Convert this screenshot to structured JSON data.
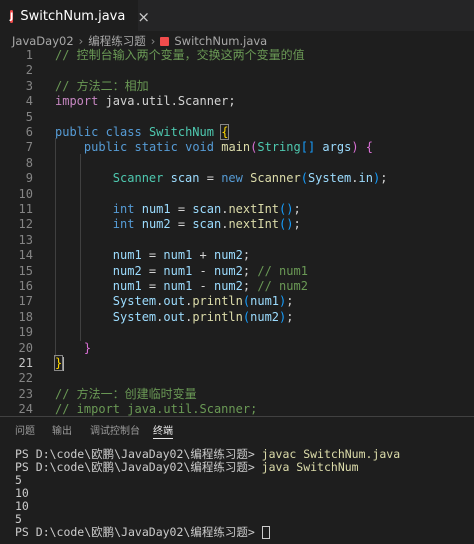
{
  "tab": {
    "icon": "J",
    "label": "SwitchNum.java",
    "close": "×"
  },
  "breadcrumb": {
    "parts": [
      "JavaDay02",
      "编程练习题",
      "SwitchNum.java"
    ],
    "separator": "›"
  },
  "editor": {
    "active_line": "21",
    "lines": [
      {
        "n": "1",
        "guides": [],
        "tokens": [
          {
            "t": "// 控制台输入两个变量，交换这两个变量的值",
            "c": "cm"
          }
        ]
      },
      {
        "n": "2",
        "guides": [],
        "tokens": []
      },
      {
        "n": "3",
        "guides": [],
        "tokens": [
          {
            "t": "// 方法二：相加",
            "c": "cm"
          }
        ]
      },
      {
        "n": "4",
        "guides": [],
        "tokens": [
          {
            "t": "import",
            "c": "kwc"
          },
          {
            "t": " java.util.Scanner;",
            "c": "pl"
          }
        ]
      },
      {
        "n": "5",
        "guides": [],
        "tokens": []
      },
      {
        "n": "6",
        "guides": [],
        "tokens": [
          {
            "t": "public",
            "c": "kw"
          },
          {
            "t": " ",
            "c": "pl"
          },
          {
            "t": "class",
            "c": "kw"
          },
          {
            "t": " ",
            "c": "pl"
          },
          {
            "t": "SwitchNum",
            "c": "ty"
          },
          {
            "t": " ",
            "c": "pl"
          },
          {
            "t": "{",
            "c": "br1 box"
          }
        ]
      },
      {
        "n": "7",
        "guides": [
          0
        ],
        "tokens": [
          {
            "t": "    ",
            "c": "pl"
          },
          {
            "t": "public",
            "c": "kw"
          },
          {
            "t": " ",
            "c": "pl"
          },
          {
            "t": "static",
            "c": "kw"
          },
          {
            "t": " ",
            "c": "pl"
          },
          {
            "t": "void",
            "c": "kw"
          },
          {
            "t": " ",
            "c": "pl"
          },
          {
            "t": "main",
            "c": "fn"
          },
          {
            "t": "(",
            "c": "br2"
          },
          {
            "t": "String",
            "c": "ty"
          },
          {
            "t": "[]",
            "c": "br3"
          },
          {
            "t": " ",
            "c": "pl"
          },
          {
            "t": "args",
            "c": "var"
          },
          {
            "t": ")",
            "c": "br2"
          },
          {
            "t": " ",
            "c": "pl"
          },
          {
            "t": "{",
            "c": "br2"
          }
        ]
      },
      {
        "n": "8",
        "guides": [
          0,
          1
        ],
        "tokens": []
      },
      {
        "n": "9",
        "guides": [
          0,
          1
        ],
        "tokens": [
          {
            "t": "        ",
            "c": "pl"
          },
          {
            "t": "Scanner",
            "c": "ty"
          },
          {
            "t": " ",
            "c": "pl"
          },
          {
            "t": "scan",
            "c": "var"
          },
          {
            "t": " = ",
            "c": "pl"
          },
          {
            "t": "new",
            "c": "kw"
          },
          {
            "t": " ",
            "c": "pl"
          },
          {
            "t": "Scanner",
            "c": "fn"
          },
          {
            "t": "(",
            "c": "br3"
          },
          {
            "t": "System",
            "c": "var"
          },
          {
            "t": ".",
            "c": "pl"
          },
          {
            "t": "in",
            "c": "var"
          },
          {
            "t": ")",
            "c": "br3"
          },
          {
            "t": ";",
            "c": "pl"
          }
        ]
      },
      {
        "n": "10",
        "guides": [
          0,
          1
        ],
        "tokens": []
      },
      {
        "n": "11",
        "guides": [
          0,
          1
        ],
        "tokens": [
          {
            "t": "        ",
            "c": "pl"
          },
          {
            "t": "int",
            "c": "kw"
          },
          {
            "t": " ",
            "c": "pl"
          },
          {
            "t": "num1",
            "c": "var"
          },
          {
            "t": " = ",
            "c": "pl"
          },
          {
            "t": "scan",
            "c": "var"
          },
          {
            "t": ".",
            "c": "pl"
          },
          {
            "t": "nextInt",
            "c": "fn"
          },
          {
            "t": "()",
            "c": "br3"
          },
          {
            "t": ";",
            "c": "pl"
          }
        ]
      },
      {
        "n": "12",
        "guides": [
          0,
          1
        ],
        "tokens": [
          {
            "t": "        ",
            "c": "pl"
          },
          {
            "t": "int",
            "c": "kw"
          },
          {
            "t": " ",
            "c": "pl"
          },
          {
            "t": "num2",
            "c": "var"
          },
          {
            "t": " = ",
            "c": "pl"
          },
          {
            "t": "scan",
            "c": "var"
          },
          {
            "t": ".",
            "c": "pl"
          },
          {
            "t": "nextInt",
            "c": "fn"
          },
          {
            "t": "()",
            "c": "br3"
          },
          {
            "t": ";",
            "c": "pl"
          }
        ]
      },
      {
        "n": "13",
        "guides": [
          0,
          1
        ],
        "tokens": []
      },
      {
        "n": "14",
        "guides": [
          0,
          1
        ],
        "tokens": [
          {
            "t": "        ",
            "c": "pl"
          },
          {
            "t": "num1",
            "c": "var"
          },
          {
            "t": " = ",
            "c": "pl"
          },
          {
            "t": "num1",
            "c": "var"
          },
          {
            "t": " + ",
            "c": "pl"
          },
          {
            "t": "num2",
            "c": "var"
          },
          {
            "t": ";",
            "c": "pl"
          }
        ]
      },
      {
        "n": "15",
        "guides": [
          0,
          1
        ],
        "tokens": [
          {
            "t": "        ",
            "c": "pl"
          },
          {
            "t": "num2",
            "c": "var"
          },
          {
            "t": " = ",
            "c": "pl"
          },
          {
            "t": "num1",
            "c": "var"
          },
          {
            "t": " - ",
            "c": "pl"
          },
          {
            "t": "num2",
            "c": "var"
          },
          {
            "t": "; ",
            "c": "pl"
          },
          {
            "t": "// num1",
            "c": "cm"
          }
        ]
      },
      {
        "n": "16",
        "guides": [
          0,
          1
        ],
        "tokens": [
          {
            "t": "        ",
            "c": "pl"
          },
          {
            "t": "num1",
            "c": "var"
          },
          {
            "t": " = ",
            "c": "pl"
          },
          {
            "t": "num1",
            "c": "var"
          },
          {
            "t": " - ",
            "c": "pl"
          },
          {
            "t": "num2",
            "c": "var"
          },
          {
            "t": "; ",
            "c": "pl"
          },
          {
            "t": "// num2",
            "c": "cm"
          }
        ]
      },
      {
        "n": "17",
        "guides": [
          0,
          1
        ],
        "tokens": [
          {
            "t": "        ",
            "c": "pl"
          },
          {
            "t": "System",
            "c": "var"
          },
          {
            "t": ".",
            "c": "pl"
          },
          {
            "t": "out",
            "c": "var"
          },
          {
            "t": ".",
            "c": "pl"
          },
          {
            "t": "println",
            "c": "fn"
          },
          {
            "t": "(",
            "c": "br3"
          },
          {
            "t": "num1",
            "c": "var"
          },
          {
            "t": ")",
            "c": "br3"
          },
          {
            "t": ";",
            "c": "pl"
          }
        ]
      },
      {
        "n": "18",
        "guides": [
          0,
          1
        ],
        "tokens": [
          {
            "t": "        ",
            "c": "pl"
          },
          {
            "t": "System",
            "c": "var"
          },
          {
            "t": ".",
            "c": "pl"
          },
          {
            "t": "out",
            "c": "var"
          },
          {
            "t": ".",
            "c": "pl"
          },
          {
            "t": "println",
            "c": "fn"
          },
          {
            "t": "(",
            "c": "br3"
          },
          {
            "t": "num2",
            "c": "var"
          },
          {
            "t": ")",
            "c": "br3"
          },
          {
            "t": ";",
            "c": "pl"
          }
        ]
      },
      {
        "n": "19",
        "guides": [
          0,
          1
        ],
        "tokens": []
      },
      {
        "n": "20",
        "guides": [
          0
        ],
        "tokens": [
          {
            "t": "    ",
            "c": "pl"
          },
          {
            "t": "}",
            "c": "br2"
          }
        ]
      },
      {
        "n": "21",
        "guides": [],
        "tokens": [
          {
            "t": "}",
            "c": "br1 box"
          },
          {
            "t": "|",
            "c": "cursor"
          }
        ]
      },
      {
        "n": "22",
        "guides": [],
        "tokens": []
      },
      {
        "n": "23",
        "guides": [],
        "tokens": [
          {
            "t": "// 方法一：创建临时变量",
            "c": "cm"
          }
        ]
      },
      {
        "n": "24",
        "guides": [],
        "tokens": [
          {
            "t": "// import java.util.Scanner;",
            "c": "cm"
          }
        ]
      }
    ]
  },
  "panel": {
    "tabs": [
      {
        "label": "问题",
        "active": false
      },
      {
        "label": "输出",
        "active": false
      },
      {
        "label": "调试控制台",
        "active": false
      },
      {
        "label": "终端",
        "active": true
      }
    ],
    "terminal": [
      {
        "prompt": "PS D:\\code\\欧鹏\\JavaDay02\\编程练习题>",
        "cmd": "javac SwitchNum.java"
      },
      {
        "prompt": "PS D:\\code\\欧鹏\\JavaDay02\\编程练习题>",
        "cmd": "java SwitchNum"
      },
      {
        "text": "5"
      },
      {
        "text": "10"
      },
      {
        "text": "10"
      },
      {
        "text": "5"
      },
      {
        "prompt": "PS D:\\code\\欧鹏\\JavaDay02\\编程练习题>",
        "cursor": true
      }
    ]
  }
}
